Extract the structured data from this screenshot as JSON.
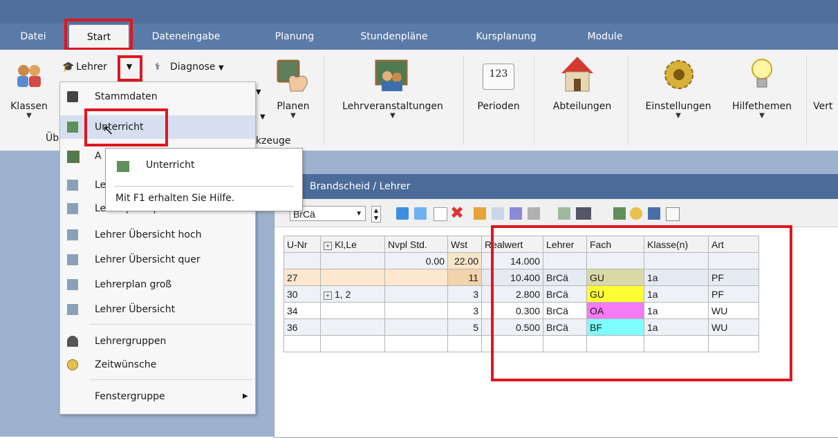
{
  "menu_tabs": [
    "Datei",
    "Start",
    "Dateneingabe",
    "Planung",
    "Stundenpläne",
    "Kursplanung",
    "Module"
  ],
  "ribbon": {
    "klassen": "Klassen",
    "lehrer": "Lehrer",
    "diagnose": "Diagnose",
    "planen": "Planen",
    "lehrveranstaltungen": "Lehrveranstaltungen",
    "perioden": "Perioden",
    "abteilungen": "Abteilungen",
    "einstellungen": "Einstellungen",
    "hilfethemen": "Hilfethemen",
    "vert": "Vert",
    "group_ueb": "Üb",
    "group_werkzeuge": "kzeuge",
    "perioden_icon_text": "123"
  },
  "dropdown_items": [
    {
      "label": "Stammdaten"
    },
    {
      "label": "Unterricht"
    },
    {
      "label": "A"
    },
    {
      "label": "Le"
    },
    {
      "label": "Lehrerplan quer"
    },
    {
      "label": "Lehrer Übersicht hoch"
    },
    {
      "label": "Lehrer Übersicht quer"
    },
    {
      "label": "Lehrerplan groß"
    },
    {
      "label": "Lehrer Übersicht"
    },
    {
      "label": "Lehrergruppen"
    },
    {
      "label": "Zeitwünsche"
    },
    {
      "label": "Fenstergruppe"
    }
  ],
  "tooltip": {
    "title": "Unterricht",
    "help": "Mit F1 erhalten Sie Hilfe."
  },
  "doc_window": {
    "title": "Brandscheid / Lehrer",
    "teacher_select": "BrCä"
  },
  "table": {
    "headers": [
      "U-Nr",
      "Kl,Le",
      "Nvpl Std.",
      "Wst",
      "Realwert",
      "Lehrer",
      "Fach",
      "Klasse(n)",
      "Art"
    ],
    "summary": {
      "nvpl": "0.00",
      "wst": "22.00",
      "realwert": "14.000"
    },
    "rows": [
      {
        "unr": "27",
        "klle": "",
        "nvpl": "",
        "wst": "11",
        "realwert": "10.400",
        "lehrer": "BrCä",
        "fach": "GU",
        "klasse": "1a",
        "art": "PF"
      },
      {
        "unr": "30",
        "klle": "1, 2",
        "nvpl": "",
        "wst": "3",
        "realwert": "2.800",
        "lehrer": "BrCä",
        "fach": "GU",
        "klasse": "1a",
        "art": "PF"
      },
      {
        "unr": "34",
        "klle": "",
        "nvpl": "",
        "wst": "3",
        "realwert": "0.300",
        "lehrer": "BrCä",
        "fach": "OA",
        "klasse": "1a",
        "art": "WU"
      },
      {
        "unr": "36",
        "klle": "",
        "nvpl": "",
        "wst": "5",
        "realwert": "0.500",
        "lehrer": "BrCä",
        "fach": "BF",
        "klasse": "1a",
        "art": "WU"
      }
    ]
  },
  "colors": {
    "title_bar": "#4f6f9c",
    "menu_bar": "#5a7aa8",
    "highlight": "#e0151f",
    "fach_gu_row1": "#d9d9a6",
    "fach_gu": "#ffff33",
    "fach_oa": "#f57af5",
    "fach_bf": "#7fffff"
  }
}
